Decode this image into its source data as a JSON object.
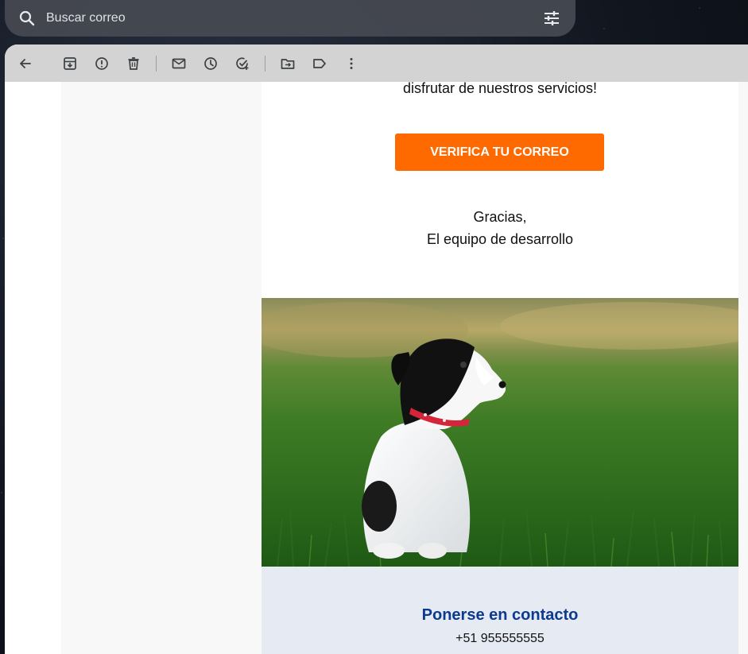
{
  "search": {
    "placeholder": "Buscar correo",
    "icon": "search-icon",
    "options_icon": "tune-icon"
  },
  "toolbar": {
    "buttons": [
      {
        "name": "back",
        "icon": "arrow-left-icon"
      },
      {
        "name": "archive",
        "icon": "archive-icon"
      },
      {
        "name": "report-spam",
        "icon": "report-icon"
      },
      {
        "name": "delete",
        "icon": "trash-icon"
      },
      {
        "name": "mark-unread",
        "icon": "mail-icon"
      },
      {
        "name": "snooze",
        "icon": "clock-icon"
      },
      {
        "name": "add-to-tasks",
        "icon": "task-add-icon"
      },
      {
        "name": "move-to",
        "icon": "folder-move-icon"
      },
      {
        "name": "labels",
        "icon": "label-icon"
      },
      {
        "name": "more",
        "icon": "more-vert-icon"
      }
    ]
  },
  "email": {
    "intro_line": "disfrutar de nuestros servicios!",
    "cta_label": "VERIFICA TU CORREO",
    "signoff_line1": "Gracias,",
    "signoff_line2": "El equipo de desarrollo",
    "footer_title": "Ponerse en contacto",
    "footer_phone": "+51 955555555"
  },
  "colors": {
    "cta": "#ff6a00",
    "footer_bg": "#e6eaf3",
    "footer_title": "#0b3a8e",
    "toolbar_bg": "#d3d3d3"
  }
}
